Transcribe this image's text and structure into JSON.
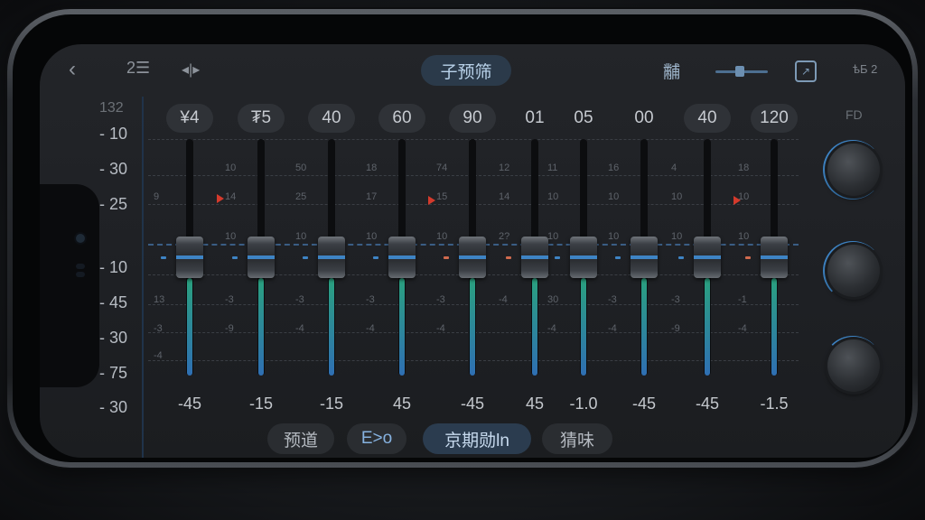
{
  "app": {
    "preset_label": "子预筛",
    "top_right_label": "黼",
    "version_label": "ѣБ 2"
  },
  "scale": {
    "top": "132",
    "labels": [
      "- 10",
      "- 30",
      "- 25",
      "- 10",
      "- 45",
      "- 30",
      "- 75",
      "- 30"
    ]
  },
  "bands": [
    {
      "value": "¥4",
      "gain": "-45",
      "ticks": [
        "",
        "9",
        "",
        "13",
        "-3",
        "-4"
      ],
      "level": 0.5,
      "color": "#2aa17f"
    },
    {
      "value": "₮5",
      "gain": "-15",
      "ticks": [
        "10",
        "14",
        "10",
        "-3",
        "-9"
      ],
      "level": 0.5,
      "color": "#2aa17f"
    },
    {
      "value": "40",
      "gain": "-15",
      "ticks": [
        "50",
        "25",
        "10",
        "-3",
        "-4"
      ],
      "level": 0.5,
      "color": "#2aa17f"
    },
    {
      "value": "60",
      "gain": "45",
      "ticks": [
        "18",
        "17",
        "10",
        "-3",
        "-4"
      ],
      "level": 0.5,
      "color": "#2aa17f"
    },
    {
      "value": "90",
      "gain": "-45",
      "ticks": [
        "74",
        "15",
        "10",
        "-3",
        "-4"
      ],
      "level": 0.5,
      "color": "#2aa17f"
    },
    {
      "value": "01",
      "gain": "45",
      "ticks": [
        "12",
        "14",
        "2?",
        "-4"
      ],
      "level": 0.5,
      "color": "#2aa17f"
    },
    {
      "value": "05",
      "gain": "-1.0",
      "ticks": [
        "11",
        "10",
        "10",
        "30",
        "-4"
      ],
      "level": 0.5,
      "color": "#2aa17f"
    },
    {
      "value": "00",
      "gain": "-45",
      "ticks": [
        "16",
        "10",
        "10",
        "-3",
        "-4"
      ],
      "level": 0.5,
      "color": "#2aa17f"
    },
    {
      "value": "40",
      "gain": "-45",
      "ticks": [
        "4",
        "10",
        "10",
        "-3",
        "-9"
      ],
      "level": 0.5,
      "color": "#2aa17f"
    },
    {
      "value": "120",
      "gain": "-1.5",
      "ticks": [
        "18",
        "10",
        "10",
        "-1",
        "-4"
      ],
      "level": 0.5,
      "color": "#2aa17f"
    }
  ],
  "knobs": {
    "label": "FD",
    "items": [
      {
        "name": "knob-1",
        "level": 0.7
      },
      {
        "name": "knob-2",
        "level": 0.55
      },
      {
        "name": "knob-3",
        "level": 0.2
      }
    ]
  },
  "tabs": [
    {
      "label": "预道",
      "active": false
    },
    {
      "label": "E>o",
      "active": false
    },
    {
      "label": "京期勋ln",
      "active": true
    },
    {
      "label": "猜味",
      "active": false
    }
  ],
  "colors": {
    "accent": "#3e84c4",
    "fill_top": "#2aa17f",
    "fill_bottom": "#2f6fb3",
    "marker": "#d43a2c"
  }
}
